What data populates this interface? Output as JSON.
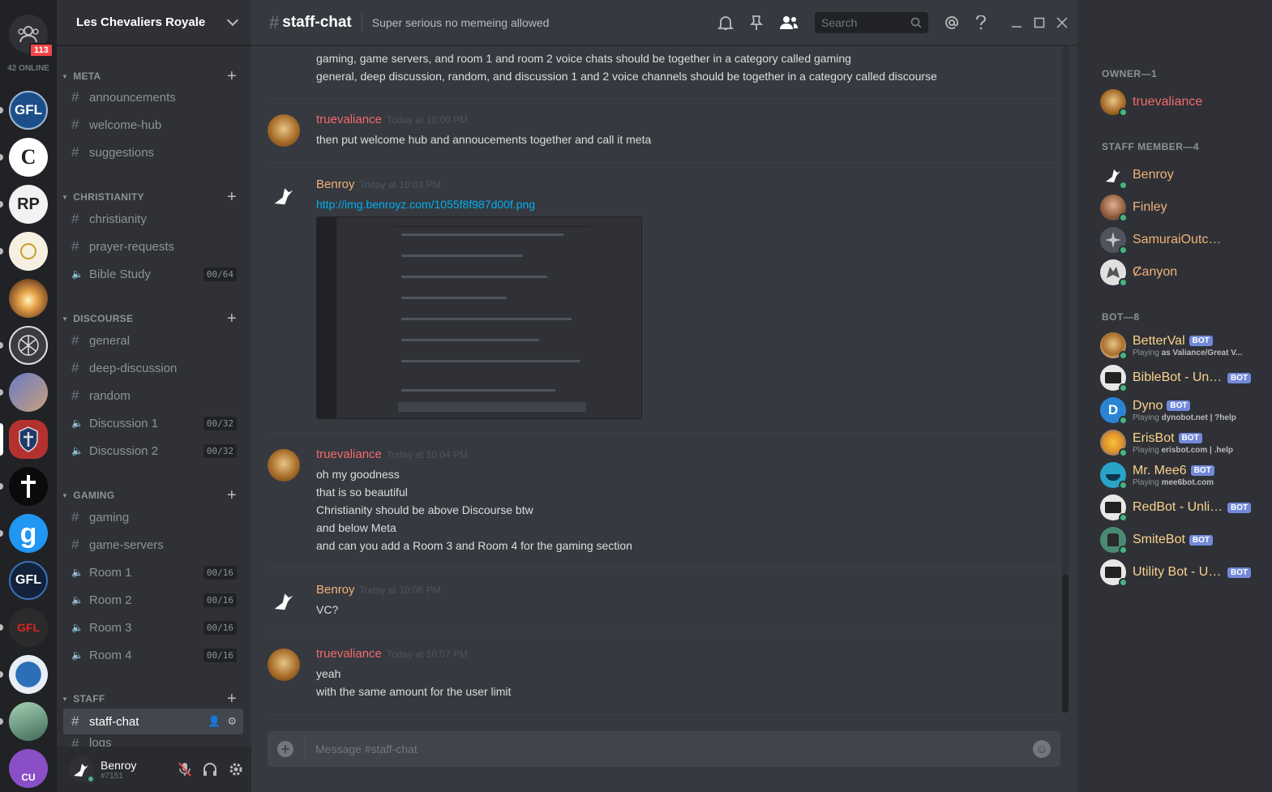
{
  "rail": {
    "badge": "113",
    "online": "42 ONLINE",
    "servers": [
      {
        "name": "gfl-server",
        "label": "GFL",
        "bg": "#1c4f8a"
      },
      {
        "name": "c-server",
        "label": "C",
        "bg": "#ffffff"
      },
      {
        "name": "rp-server",
        "label": "RP",
        "bg": "#f2f2f2"
      },
      {
        "name": "guardians-of-faith-server",
        "label": "",
        "bg": "#f6f0e3"
      },
      {
        "name": "sunset-server",
        "label": "",
        "bg": "#c98a3a"
      },
      {
        "name": "chi-rho-server",
        "label": "",
        "bg": "#3a3c40"
      },
      {
        "name": "jesus-avatar-server",
        "label": "",
        "bg": "#6a7ac8"
      },
      {
        "name": "les-chevaliers-royale-server",
        "label": "",
        "bg": "#b3322f"
      },
      {
        "name": "cross-server",
        "label": "",
        "bg": "#0a0a0a"
      },
      {
        "name": "g-server",
        "label": "g",
        "bg": "#2196f3"
      },
      {
        "name": "gfl-dark-server",
        "label": "GFL",
        "bg": "#13223a"
      },
      {
        "name": "gfl-ze-server",
        "label": "GFL",
        "bg": "#2b2b2b"
      },
      {
        "name": "globe-server",
        "label": "",
        "bg": "#e8eef6"
      },
      {
        "name": "landscape-server",
        "label": "",
        "bg": "#6b9a7c"
      },
      {
        "name": "cu-server",
        "label": "CU",
        "bg": "#8a4fc7"
      }
    ]
  },
  "guild": {
    "name": "Les Chevaliers Royale"
  },
  "categories": {
    "meta": "META",
    "christianity": "CHRISTIANITY",
    "discourse": "DISCOURSE",
    "gaming": "GAMING",
    "staff": "STAFF"
  },
  "channels": {
    "announcements": "announcements",
    "welcome_hub": "welcome-hub",
    "suggestions": "suggestions",
    "christianity": "christianity",
    "prayer_requests": "prayer-requests",
    "bible_study": "Bible Study",
    "bible_study_count": "00/64",
    "general": "general",
    "deep_discussion": "deep-discussion",
    "random": "random",
    "discussion1": "Discussion 1",
    "discussion1_count": "00/32",
    "discussion2": "Discussion 2",
    "discussion2_count": "00/32",
    "gaming": "gaming",
    "game_servers": "game-servers",
    "room1": "Room 1",
    "room1_count": "00/16",
    "room2": "Room 2",
    "room2_count": "00/16",
    "room3": "Room 3",
    "room3_count": "00/16",
    "room4": "Room 4",
    "room4_count": "00/16",
    "staff_chat": "staff-chat",
    "logs": "logs"
  },
  "user": {
    "name": "Benroy",
    "discriminator": "#7151"
  },
  "header": {
    "channel": "staff-chat",
    "topic": "Super serious no memeing allowed",
    "search_placeholder": "Search"
  },
  "messages": {
    "m0_line1": "gaming, game servers, and room 1 and room 2 voice chats should be together in a category called gaming",
    "m0_line2": "general, deep discussion, random, and discussion 1 and 2 voice channels should be together in a category called discourse",
    "m1_author": "truevaliance",
    "m1_ts": "Today at 10:00 PM",
    "m1_line1": "then put welcome hub and annoucements together and call it meta",
    "m2_author": "Benroy",
    "m2_ts": "Today at 10:03 PM",
    "m2_link": "http://img.benroyz.com/1055f8f987d00f.png",
    "m3_author": "truevaliance",
    "m3_ts": "Today at 10:04 PM",
    "m3_line1": "oh my goodness",
    "m3_line2": "that is so beautiful",
    "m3_line3": "Christianity should be above Discourse btw",
    "m3_line4": "and below Meta",
    "m3_line5": "and can you add a Room 3 and Room 4 for the gaming section",
    "m4_author": "Benroy",
    "m4_ts": "Today at 10:06 PM",
    "m4_line1": "VC?",
    "m5_author": "truevaliance",
    "m5_ts": "Today at 10:07 PM",
    "m5_line1": "yeah",
    "m5_line2": "with the same amount for the user limit"
  },
  "composer": {
    "placeholder": "Message #staff-chat"
  },
  "members": {
    "owner_heading": "OWNER—1",
    "staff_heading": "STAFF MEMBER—4",
    "bot_heading": "BOT—8",
    "bot_tag": "BOT",
    "owner": "truevaliance",
    "staff1": "Benroy",
    "staff2": "Finley",
    "staff3": "SamuraiOutcast",
    "staff4": "Ȼanyon",
    "bot1": "BetterVal",
    "bot1_prefix": "Playing",
    "bot1_game": "as Valiance/Great V...",
    "bot2": "BibleBot - Unli...",
    "bot3": "Dyno",
    "bot3_prefix": "Playing",
    "bot3_game": "dynobot.net | ?help",
    "bot4": "ErisBot",
    "bot4_prefix": "Playing",
    "bot4_game": "erisbot.com | .help",
    "bot5": "Mr. Mee6",
    "bot5_prefix": "Playing",
    "bot5_game": "mee6bot.com",
    "bot6": "RedBot - Unlim...",
    "bot7": "SmiteBot",
    "bot8": "Utility Bot - Un..."
  },
  "colors": {
    "owner": "#f26b6b",
    "staff": "#f0b27a",
    "bot": "#fbd38d",
    "online": "#43b581",
    "mention_badge": "#f04747",
    "bot_tag": "#7289da"
  }
}
